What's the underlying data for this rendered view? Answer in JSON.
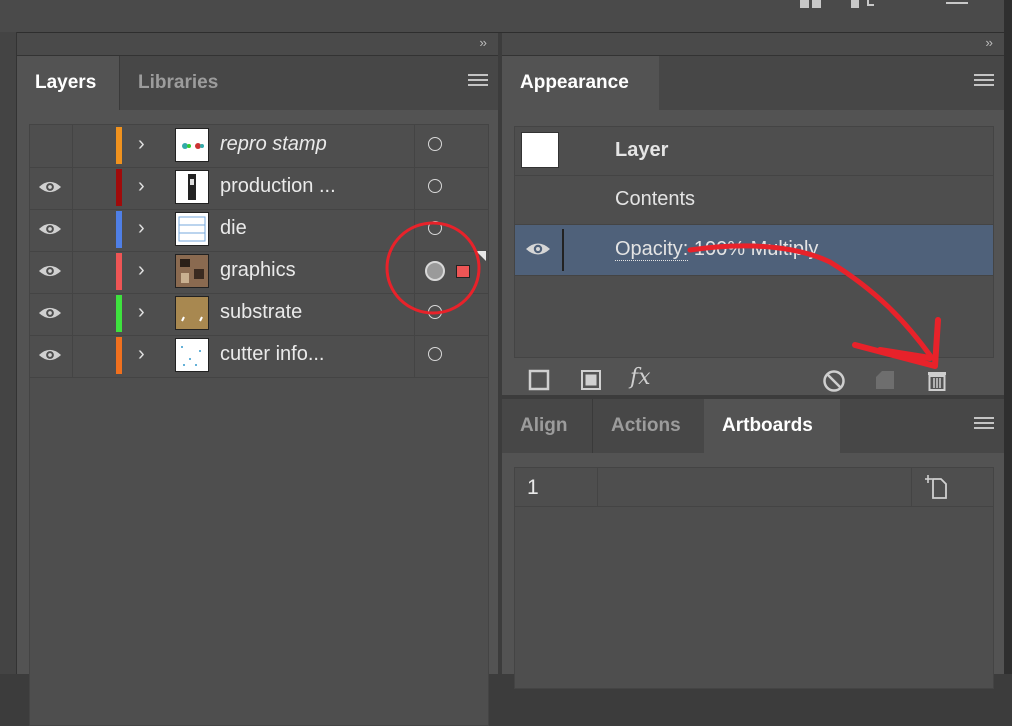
{
  "layers_panel": {
    "tabs": [
      {
        "label": "Layers"
      },
      {
        "label": "Libraries"
      }
    ],
    "layers": [
      {
        "name": "repro stamp",
        "color": "#f0921e",
        "visible": false,
        "italic": true,
        "selected": false
      },
      {
        "name": "production ...",
        "color": "#a00b0b",
        "visible": true,
        "italic": false,
        "selected": false
      },
      {
        "name": "die",
        "color": "#4f7fe6",
        "visible": true,
        "italic": false,
        "selected": false
      },
      {
        "name": "graphics",
        "color": "#ee5555",
        "visible": true,
        "italic": false,
        "selected": true
      },
      {
        "name": "substrate",
        "color": "#3ee23e",
        "visible": true,
        "italic": false,
        "selected": false
      },
      {
        "name": "cutter info...",
        "color": "#f0701e",
        "visible": true,
        "italic": false,
        "selected": false
      }
    ]
  },
  "appearance_panel": {
    "tab": "Appearance",
    "rows": {
      "layer": "Layer",
      "contents": "Contents",
      "opacity": "Opacity:",
      "opacity_value": "100% Multiply"
    },
    "footer_icons": [
      "new-stroke-icon",
      "new-fill-icon",
      "fx-icon",
      "clear-appearance-icon",
      "duplicate-item-icon",
      "delete-item-icon"
    ],
    "fx_label": "fx"
  },
  "bottom_panel": {
    "tabs": [
      {
        "label": "Align"
      },
      {
        "label": "Actions"
      },
      {
        "label": "Artboards"
      }
    ],
    "artboards": [
      {
        "number": "1"
      }
    ]
  },
  "collapse_glyph": "››",
  "annotation_color": "#e8222a"
}
